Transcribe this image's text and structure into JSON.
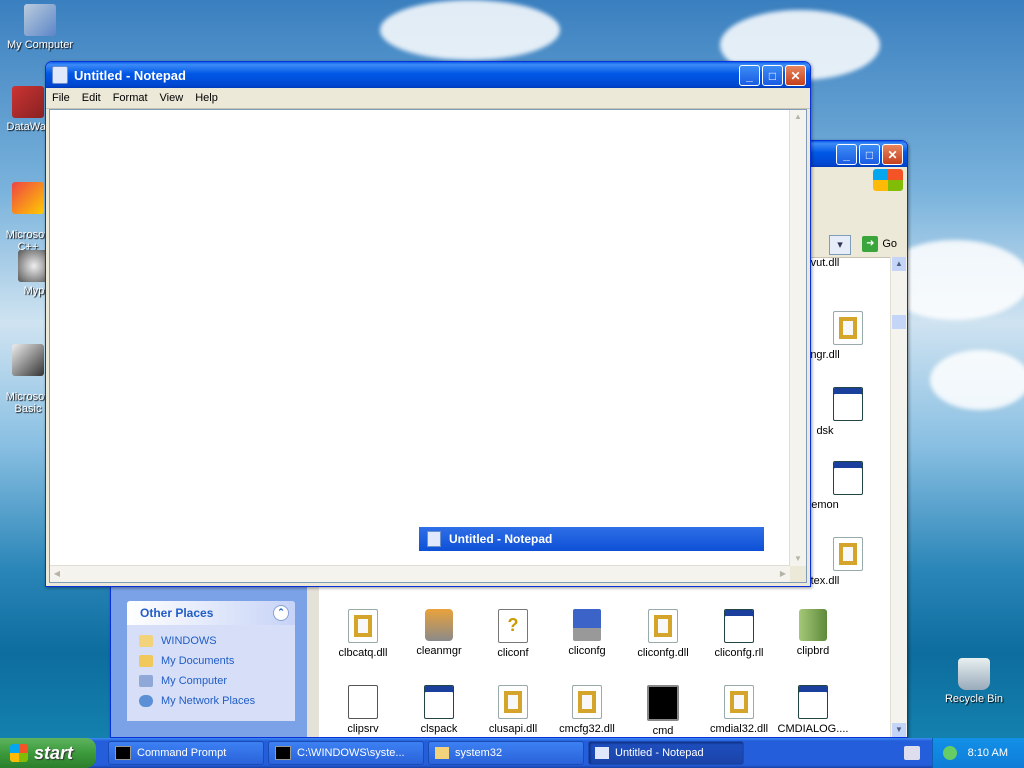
{
  "desktop": {
    "icons": [
      {
        "label": "My Computer"
      },
      {
        "label": "DataWar"
      },
      {
        "label": "Microsoft\nC++"
      },
      {
        "label": "Myp"
      },
      {
        "label": "Microsoft\nBasic"
      },
      {
        "label": "Recycle Bin"
      }
    ]
  },
  "notepad": {
    "title": "Untitled - Notepad",
    "menu": [
      "File",
      "Edit",
      "Format",
      "View",
      "Help"
    ],
    "drag_title": "Untitled - Notepad"
  },
  "explorer": {
    "go_label": "Go",
    "other_places": {
      "header": "Other Places",
      "items": [
        "WINDOWS",
        "My Documents",
        "My Computer",
        "My Network Places"
      ]
    },
    "partial_files": [
      "vut.dll",
      "ngr.dll",
      "dsk",
      "emon",
      "tex.dll"
    ],
    "files_row1": [
      "clbcatq.dll",
      "cleanmgr",
      "cliconf",
      "cliconfg",
      "cliconfg.dll",
      "cliconfg.rll",
      "clipbrd"
    ],
    "files_row2": [
      "clipsrv",
      "clspack",
      "clusapi.dll",
      "cmcfg32.dll",
      "cmd",
      "cmdial32.dll",
      "CMDIALOG...."
    ]
  },
  "taskbar": {
    "start_label": "start",
    "buttons": [
      "Command Prompt",
      "C:\\WINDOWS\\syste...",
      "system32",
      "Untitled - Notepad"
    ],
    "clock": "8:10 AM"
  }
}
